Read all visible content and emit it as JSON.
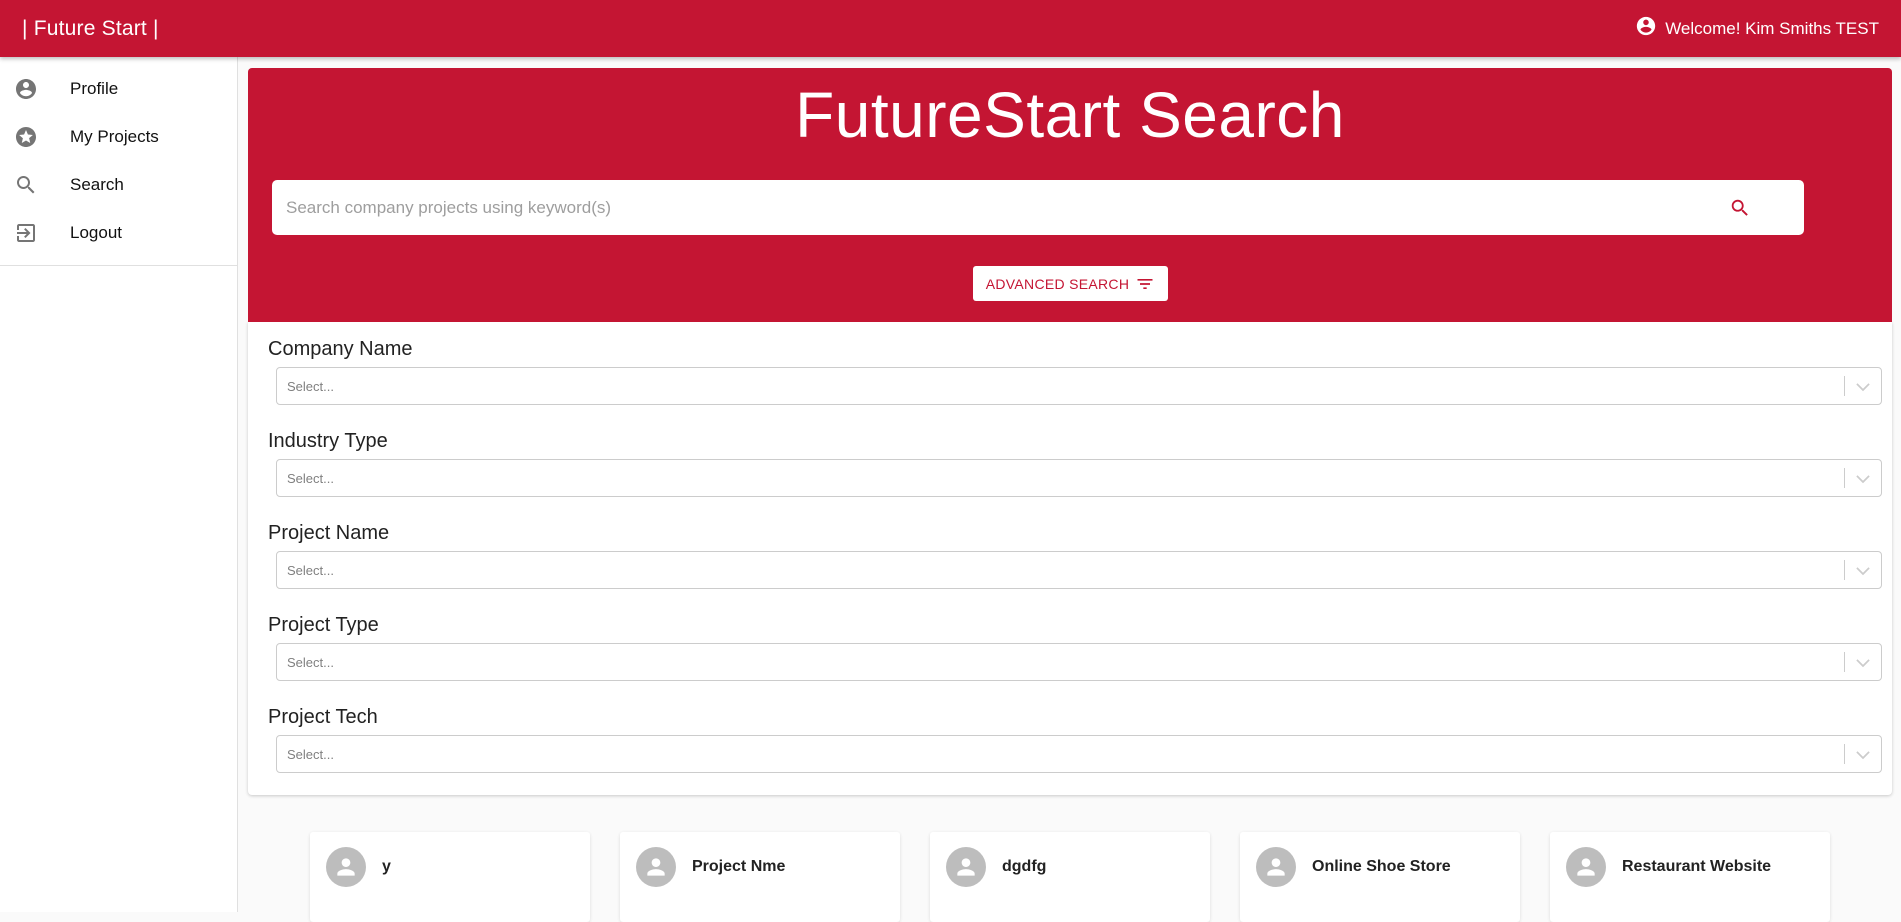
{
  "header": {
    "brand": "| Future Start |",
    "welcome": "Welcome! Kim Smiths TEST",
    "account_icon": "account-circle-icon"
  },
  "sidebar": {
    "items": [
      {
        "label": "Profile",
        "icon": "account-circle-icon"
      },
      {
        "label": "My Projects",
        "icon": "stars-icon"
      },
      {
        "label": "Search",
        "icon": "search-icon"
      },
      {
        "label": "Logout",
        "icon": "exit-to-app-icon"
      }
    ]
  },
  "hero": {
    "title": "FutureStart Search",
    "search_placeholder": "Search company projects using keyword(s)",
    "search_value": "",
    "advanced_label": "ADVANCED SEARCH"
  },
  "filters": [
    {
      "label": "Company Name",
      "placeholder": "Select..."
    },
    {
      "label": "Industry Type",
      "placeholder": "Select..."
    },
    {
      "label": "Project Name",
      "placeholder": "Select..."
    },
    {
      "label": "Project Type",
      "placeholder": "Select..."
    },
    {
      "label": "Project Tech",
      "placeholder": "Select..."
    }
  ],
  "results": [
    {
      "title": "y"
    },
    {
      "title": "Project Nme"
    },
    {
      "title": "dgdfg"
    },
    {
      "title": "Online Shoe Store"
    },
    {
      "title": "Restaurant Website"
    }
  ],
  "colors": {
    "brand_red": "#c41533",
    "white": "#ffffff"
  }
}
